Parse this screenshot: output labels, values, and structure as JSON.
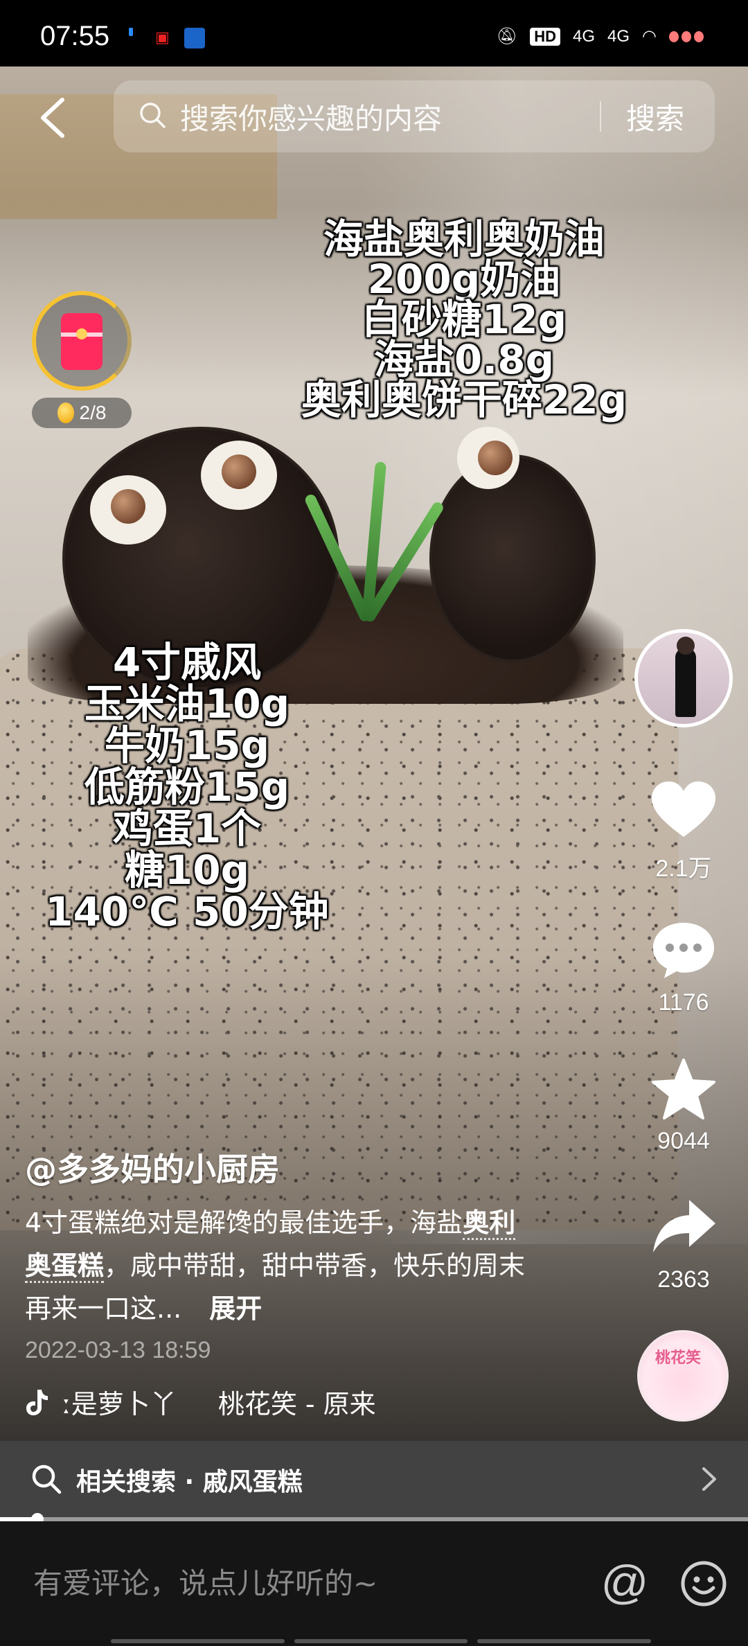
{
  "status_bar": {
    "time": "07:55",
    "network": "4G",
    "network2": "4G",
    "hd_label": "HD"
  },
  "search": {
    "placeholder": "搜索你感兴趣的内容",
    "button": "搜索"
  },
  "reward": {
    "progress_text": "2/8"
  },
  "recipe_top": [
    "海盐奥利奥奶油",
    "200g奶油",
    "白砂糖12g",
    "海盐0.8g",
    "奥利奥饼干碎22g"
  ],
  "recipe_bottom": [
    "4寸戚风",
    "玉米油10g",
    "牛奶15g",
    "低筋粉15g",
    "鸡蛋1个",
    "糖10g",
    "140°C   50分钟"
  ],
  "rail": {
    "likes": "2.1万",
    "comments": "1176",
    "favorites": "9044",
    "shares": "2363",
    "disc_label": "桃花笑"
  },
  "caption": {
    "author": "@多多妈的小厨房",
    "desc_part1": "4寸蛋糕绝对是解馋的最佳选手，海盐",
    "desc_keyword": "奥利奥蛋糕",
    "desc_part2": "，咸中带甜，甜中带香，快乐的周末再来一口这...",
    "expand": "展开",
    "timestamp": "2022-03-13 18:59",
    "music_author": "ː是萝卜丫",
    "music_title": "桃花笑 - 原来"
  },
  "related_search": {
    "text": "相关搜索 · 戚风蛋糕"
  },
  "playback": {
    "progress": 0.05
  },
  "comment_bar": {
    "placeholder": "有爱评论，说点儿好听的~",
    "at_symbol": "@"
  }
}
